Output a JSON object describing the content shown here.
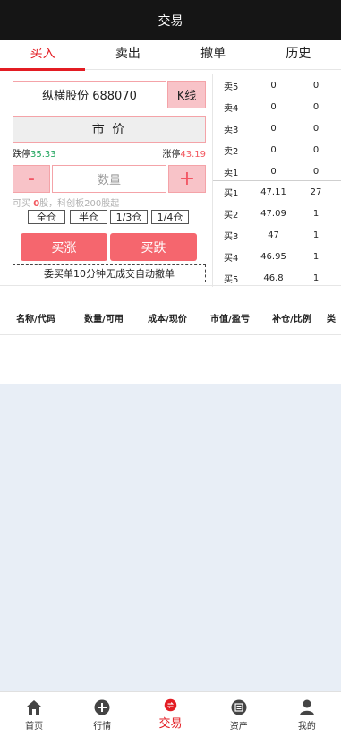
{
  "header": {
    "title": "交易"
  },
  "tabs": [
    "买入",
    "卖出",
    "撤单",
    "历史"
  ],
  "order": {
    "stock": "纵横股份 688070",
    "kline_label": "K线",
    "price_type": "市 价",
    "limit_down_label": "跌停",
    "limit_down_value": "35.33",
    "limit_up_label": "涨停",
    "limit_up_value": "43.19",
    "minus": "-",
    "plus": "+",
    "qty_placeholder": "数量",
    "avail_prefix": "可买 ",
    "avail_value": "0",
    "avail_suffix": "股，科创板200股起",
    "positions": [
      "全仓",
      "半仓",
      "1/3仓",
      "1/4仓"
    ],
    "buy_up_label": "买涨",
    "buy_down_label": "买跌",
    "notice": "委买单10分钟无成交自动撤单"
  },
  "order_book": {
    "asks": [
      {
        "level": "卖5",
        "price": "0",
        "volume": "0"
      },
      {
        "level": "卖4",
        "price": "0",
        "volume": "0"
      },
      {
        "level": "卖3",
        "price": "0",
        "volume": "0"
      },
      {
        "level": "卖2",
        "price": "0",
        "volume": "0"
      },
      {
        "level": "卖1",
        "price": "0",
        "volume": "0"
      }
    ],
    "bids": [
      {
        "level": "买1",
        "price": "47.11",
        "volume": "27"
      },
      {
        "level": "买2",
        "price": "47.09",
        "volume": "1"
      },
      {
        "level": "买3",
        "price": "47",
        "volume": "1"
      },
      {
        "level": "买4",
        "price": "46.95",
        "volume": "1"
      },
      {
        "level": "买5",
        "price": "46.8",
        "volume": "1"
      }
    ]
  },
  "positions_table": {
    "headers": [
      "名称/代码",
      "数量/可用",
      "成本/现价",
      "市值/盈亏",
      "补仓/比例",
      "类"
    ]
  },
  "bottom_nav": [
    {
      "label": "首页",
      "icon": "home-icon"
    },
    {
      "label": "行情",
      "icon": "market-plus-icon"
    },
    {
      "label": "交易",
      "icon": "trade-icon"
    },
    {
      "label": "资产",
      "icon": "assets-icon"
    },
    {
      "label": "我的",
      "icon": "profile-icon"
    }
  ],
  "colors": {
    "accent": "#e31c23",
    "button_red": "#f5666e",
    "limit_up": "#f2575e",
    "limit_down": "#1aa259"
  }
}
